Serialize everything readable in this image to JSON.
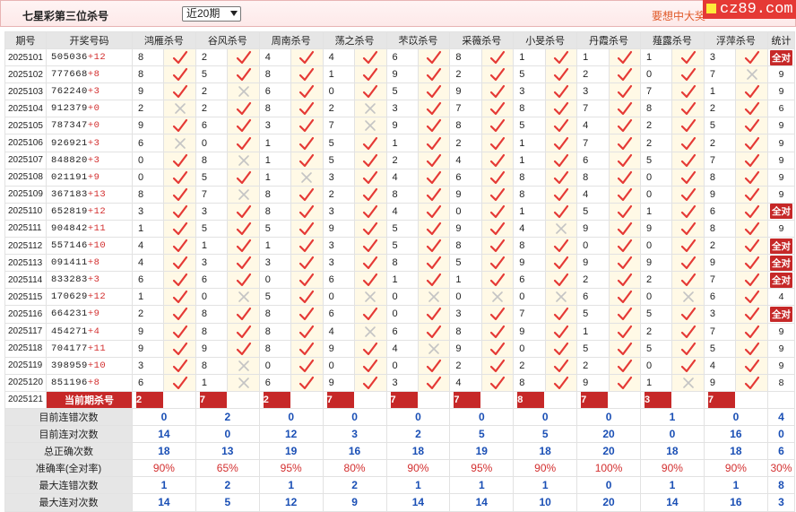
{
  "header": {
    "title": "七星彩第三位杀号",
    "period_select": "近20期",
    "promo": "要想中大奖",
    "brand": "cz89.com"
  },
  "columns": [
    "期号",
    "开奖号码",
    "鸿雁杀号",
    "谷风杀号",
    "周南杀号",
    "荡之杀号",
    "芣苡杀号",
    "采薇杀号",
    "小旻杀号",
    "丹霞杀号",
    "薤露杀号",
    "浮萍杀号",
    "统计"
  ],
  "rows": [
    {
      "p": "2025101",
      "n": "505036",
      "s": "+12",
      "k": [
        [
          8,
          1
        ],
        [
          2,
          1
        ],
        [
          4,
          1
        ],
        [
          4,
          1
        ],
        [
          6,
          1
        ],
        [
          8,
          1
        ],
        [
          1,
          1
        ],
        [
          1,
          1
        ],
        [
          1,
          1
        ],
        [
          3,
          1
        ]
      ],
      "t": "全对"
    },
    {
      "p": "2025102",
      "n": "777668",
      "s": "+8",
      "k": [
        [
          8,
          1
        ],
        [
          5,
          1
        ],
        [
          8,
          1
        ],
        [
          1,
          1
        ],
        [
          9,
          1
        ],
        [
          2,
          1
        ],
        [
          5,
          1
        ],
        [
          2,
          1
        ],
        [
          0,
          1
        ],
        [
          7,
          0
        ]
      ],
      "t": "9"
    },
    {
      "p": "2025103",
      "n": "762240",
      "s": "+3",
      "k": [
        [
          9,
          1
        ],
        [
          2,
          0
        ],
        [
          6,
          1
        ],
        [
          0,
          1
        ],
        [
          5,
          1
        ],
        [
          9,
          1
        ],
        [
          3,
          1
        ],
        [
          3,
          1
        ],
        [
          7,
          1
        ],
        [
          1,
          1
        ]
      ],
      "t": "9"
    },
    {
      "p": "2025104",
      "n": "912379",
      "s": "+0",
      "k": [
        [
          2,
          0
        ],
        [
          2,
          1
        ],
        [
          8,
          1
        ],
        [
          2,
          0
        ],
        [
          3,
          1
        ],
        [
          7,
          1
        ],
        [
          8,
          1
        ],
        [
          7,
          1
        ],
        [
          8,
          1
        ],
        [
          2,
          1
        ]
      ],
      "t": "6"
    },
    {
      "p": "2025105",
      "n": "787347",
      "s": "+0",
      "k": [
        [
          9,
          1
        ],
        [
          6,
          1
        ],
        [
          3,
          1
        ],
        [
          7,
          0
        ],
        [
          9,
          1
        ],
        [
          8,
          1
        ],
        [
          5,
          1
        ],
        [
          4,
          1
        ],
        [
          2,
          1
        ],
        [
          5,
          1
        ]
      ],
      "t": "9"
    },
    {
      "p": "2025106",
      "n": "926921",
      "s": "+3",
      "k": [
        [
          6,
          0
        ],
        [
          0,
          1
        ],
        [
          1,
          1
        ],
        [
          5,
          1
        ],
        [
          1,
          1
        ],
        [
          2,
          1
        ],
        [
          1,
          1
        ],
        [
          7,
          1
        ],
        [
          2,
          1
        ],
        [
          2,
          1
        ]
      ],
      "t": "9"
    },
    {
      "p": "2025107",
      "n": "848820",
      "s": "+3",
      "k": [
        [
          0,
          1
        ],
        [
          8,
          0
        ],
        [
          1,
          1
        ],
        [
          5,
          1
        ],
        [
          2,
          1
        ],
        [
          4,
          1
        ],
        [
          1,
          1
        ],
        [
          6,
          1
        ],
        [
          5,
          1
        ],
        [
          7,
          1
        ]
      ],
      "t": "9"
    },
    {
      "p": "2025108",
      "n": "021191",
      "s": "+9",
      "k": [
        [
          0,
          1
        ],
        [
          5,
          1
        ],
        [
          1,
          0
        ],
        [
          3,
          1
        ],
        [
          4,
          1
        ],
        [
          6,
          1
        ],
        [
          8,
          1
        ],
        [
          8,
          1
        ],
        [
          0,
          1
        ],
        [
          8,
          1
        ]
      ],
      "t": "9"
    },
    {
      "p": "2025109",
      "n": "367183",
      "s": "+13",
      "k": [
        [
          8,
          1
        ],
        [
          7,
          0
        ],
        [
          8,
          1
        ],
        [
          2,
          1
        ],
        [
          8,
          1
        ],
        [
          9,
          1
        ],
        [
          8,
          1
        ],
        [
          4,
          1
        ],
        [
          0,
          1
        ],
        [
          9,
          1
        ]
      ],
      "t": "9"
    },
    {
      "p": "2025110",
      "n": "652819",
      "s": "+12",
      "k": [
        [
          3,
          1
        ],
        [
          3,
          1
        ],
        [
          8,
          1
        ],
        [
          3,
          1
        ],
        [
          4,
          1
        ],
        [
          0,
          1
        ],
        [
          1,
          1
        ],
        [
          5,
          1
        ],
        [
          1,
          1
        ],
        [
          6,
          1
        ]
      ],
      "t": "全对"
    },
    {
      "p": "2025111",
      "n": "904842",
      "s": "+11",
      "k": [
        [
          1,
          1
        ],
        [
          5,
          1
        ],
        [
          5,
          1
        ],
        [
          9,
          1
        ],
        [
          5,
          1
        ],
        [
          9,
          1
        ],
        [
          4,
          0
        ],
        [
          9,
          1
        ],
        [
          9,
          1
        ],
        [
          8,
          1
        ]
      ],
      "t": "9"
    },
    {
      "p": "2025112",
      "n": "557146",
      "s": "+10",
      "k": [
        [
          4,
          1
        ],
        [
          1,
          1
        ],
        [
          1,
          1
        ],
        [
          3,
          1
        ],
        [
          5,
          1
        ],
        [
          8,
          1
        ],
        [
          8,
          1
        ],
        [
          0,
          1
        ],
        [
          0,
          1
        ],
        [
          2,
          1
        ]
      ],
      "t": "全对"
    },
    {
      "p": "2025113",
      "n": "091411",
      "s": "+8",
      "k": [
        [
          4,
          1
        ],
        [
          3,
          1
        ],
        [
          3,
          1
        ],
        [
          3,
          1
        ],
        [
          8,
          1
        ],
        [
          5,
          1
        ],
        [
          9,
          1
        ],
        [
          9,
          1
        ],
        [
          9,
          1
        ],
        [
          9,
          1
        ]
      ],
      "t": "全对"
    },
    {
      "p": "2025114",
      "n": "833283",
      "s": "+3",
      "k": [
        [
          6,
          1
        ],
        [
          6,
          1
        ],
        [
          0,
          1
        ],
        [
          6,
          1
        ],
        [
          1,
          1
        ],
        [
          1,
          1
        ],
        [
          6,
          1
        ],
        [
          2,
          1
        ],
        [
          2,
          1
        ],
        [
          7,
          1
        ]
      ],
      "t": "全对"
    },
    {
      "p": "2025115",
      "n": "170629",
      "s": "+12",
      "k": [
        [
          1,
          1
        ],
        [
          0,
          0
        ],
        [
          5,
          1
        ],
        [
          0,
          0
        ],
        [
          0,
          0
        ],
        [
          0,
          0
        ],
        [
          0,
          0
        ],
        [
          6,
          1
        ],
        [
          0,
          0
        ],
        [
          6,
          1
        ]
      ],
      "t": "4"
    },
    {
      "p": "2025116",
      "n": "664231",
      "s": "+9",
      "k": [
        [
          2,
          1
        ],
        [
          8,
          1
        ],
        [
          8,
          1
        ],
        [
          6,
          1
        ],
        [
          0,
          1
        ],
        [
          3,
          1
        ],
        [
          7,
          1
        ],
        [
          5,
          1
        ],
        [
          5,
          1
        ],
        [
          3,
          1
        ]
      ],
      "t": "全对"
    },
    {
      "p": "2025117",
      "n": "454271",
      "s": "+4",
      "k": [
        [
          9,
          1
        ],
        [
          8,
          1
        ],
        [
          8,
          1
        ],
        [
          4,
          0
        ],
        [
          6,
          1
        ],
        [
          8,
          1
        ],
        [
          9,
          1
        ],
        [
          1,
          1
        ],
        [
          2,
          1
        ],
        [
          7,
          1
        ]
      ],
      "t": "9"
    },
    {
      "p": "2025118",
      "n": "704177",
      "s": "+11",
      "k": [
        [
          9,
          1
        ],
        [
          9,
          1
        ],
        [
          8,
          1
        ],
        [
          9,
          1
        ],
        [
          4,
          0
        ],
        [
          9,
          1
        ],
        [
          0,
          1
        ],
        [
          5,
          1
        ],
        [
          5,
          1
        ],
        [
          5,
          1
        ]
      ],
      "t": "9"
    },
    {
      "p": "2025119",
      "n": "398959",
      "s": "+10",
      "k": [
        [
          3,
          1
        ],
        [
          8,
          0
        ],
        [
          0,
          1
        ],
        [
          0,
          1
        ],
        [
          0,
          1
        ],
        [
          2,
          1
        ],
        [
          2,
          1
        ],
        [
          2,
          1
        ],
        [
          0,
          1
        ],
        [
          4,
          1
        ]
      ],
      "t": "9"
    },
    {
      "p": "2025120",
      "n": "851196",
      "s": "+8",
      "k": [
        [
          6,
          1
        ],
        [
          1,
          0
        ],
        [
          6,
          1
        ],
        [
          9,
          1
        ],
        [
          3,
          1
        ],
        [
          4,
          1
        ],
        [
          8,
          1
        ],
        [
          9,
          1
        ],
        [
          1,
          0
        ],
        [
          9,
          1
        ]
      ],
      "t": "8"
    }
  ],
  "current": {
    "p": "2025121",
    "label": "当前期杀号",
    "vals": [
      "2",
      "7",
      "2",
      "7",
      "7",
      "7",
      "8",
      "7",
      "3",
      "7"
    ]
  },
  "stats": [
    {
      "label": "目前连错次数",
      "vals": [
        "0",
        "2",
        "0",
        "0",
        "0",
        "0",
        "0",
        "0",
        "1",
        "0",
        "4"
      ]
    },
    {
      "label": "目前连对次数",
      "vals": [
        "14",
        "0",
        "12",
        "3",
        "2",
        "5",
        "5",
        "20",
        "0",
        "16",
        "0"
      ]
    },
    {
      "label": "总正确次数",
      "vals": [
        "18",
        "13",
        "19",
        "16",
        "18",
        "19",
        "18",
        "20",
        "18",
        "18",
        "6"
      ]
    },
    {
      "label": "准确率(全对率)",
      "vals": [
        "90%",
        "65%",
        "95%",
        "80%",
        "90%",
        "95%",
        "90%",
        "100%",
        "90%",
        "90%",
        "30%"
      ],
      "pct": true
    },
    {
      "label": "最大连错次数",
      "vals": [
        "1",
        "2",
        "1",
        "2",
        "1",
        "1",
        "1",
        "0",
        "1",
        "1",
        "8"
      ]
    },
    {
      "label": "最大连对次数",
      "vals": [
        "14",
        "5",
        "12",
        "9",
        "14",
        "14",
        "10",
        "20",
        "14",
        "16",
        "3"
      ]
    }
  ]
}
